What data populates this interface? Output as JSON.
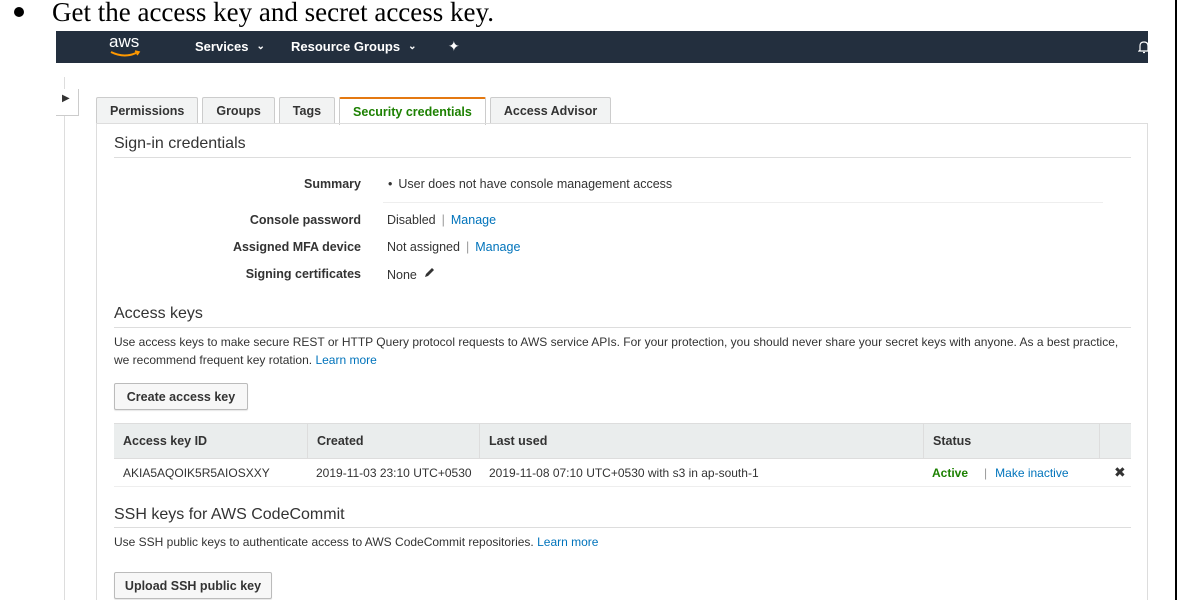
{
  "doc": {
    "instruction": "Get the access key and secret access key."
  },
  "nav": {
    "logo": "aws",
    "services": "Services",
    "resource_groups": "Resource Groups"
  },
  "tabs": [
    {
      "label": "Permissions",
      "active": false
    },
    {
      "label": "Groups",
      "active": false
    },
    {
      "label": "Tags",
      "active": false
    },
    {
      "label": "Security credentials",
      "active": true
    },
    {
      "label": "Access Advisor",
      "active": false
    }
  ],
  "signin": {
    "title": "Sign-in credentials",
    "summary_label": "Summary",
    "summary_value": "User does not have console management access",
    "console_password_label": "Console password",
    "console_password_value": "Disabled",
    "manage_1": "Manage",
    "mfa_label": "Assigned MFA device",
    "mfa_value": "Not assigned",
    "manage_2": "Manage",
    "signing_label": "Signing certificates",
    "signing_value": "None"
  },
  "access_keys": {
    "title": "Access keys",
    "description": "Use access keys to make secure REST or HTTP Query protocol requests to AWS service APIs. For your protection, you should never share your secret keys with anyone. As a best practice, we recommend frequent key rotation.",
    "learn_more": "Learn more",
    "create_button": "Create access key",
    "columns": [
      "Access key ID",
      "Created",
      "Last used",
      "Status"
    ],
    "rows": [
      {
        "id": "AKIA5AQOIK5R5AIOSXXY",
        "created": "2019-11-03 23:10 UTC+0530",
        "last_used": "2019-11-08 07:10 UTC+0530 with s3 in ap-south-1",
        "status": "Active",
        "action": "Make inactive"
      }
    ]
  },
  "ssh": {
    "title": "SSH keys for AWS CodeCommit",
    "description": "Use SSH public keys to authenticate access to AWS CodeCommit repositories.",
    "learn_more": "Learn more",
    "upload_button": "Upload SSH public key"
  },
  "colors": {
    "nav_bg": "#232f3e",
    "link": "#0073bb",
    "active_status": "#1d8102",
    "tab_accent": "#e47911"
  }
}
